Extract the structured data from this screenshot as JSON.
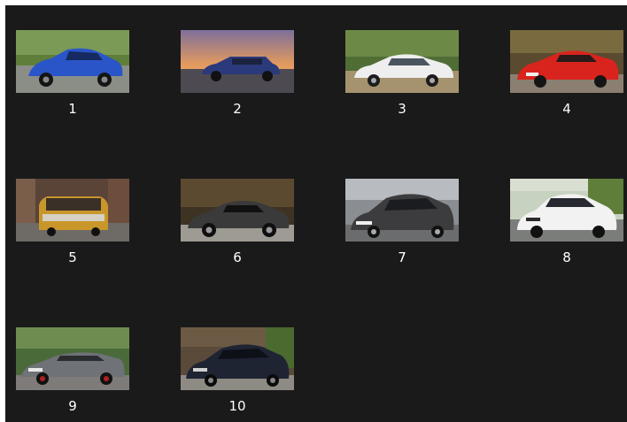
{
  "gallery": {
    "items": [
      {
        "label": "1",
        "car_color": "#2a55c8",
        "bg": "#6f8f4a"
      },
      {
        "label": "2",
        "car_color": "#2b3a7a",
        "bg": "#b97a5a"
      },
      {
        "label": "3",
        "car_color": "#eeeeee",
        "bg": "#5c7a3a"
      },
      {
        "label": "4",
        "car_color": "#d8241c",
        "bg": "#6a5a3a"
      },
      {
        "label": "5",
        "car_color": "#c9962a",
        "bg": "#6a5040"
      },
      {
        "label": "6",
        "car_color": "#3a3a3a",
        "bg": "#4a3a2a"
      },
      {
        "label": "7",
        "car_color": "#3c3c3e",
        "bg": "#8a8d91"
      },
      {
        "label": "8",
        "car_color": "#f2f2f2",
        "bg": "#7a8a6a"
      },
      {
        "label": "9",
        "car_color": "#6f7276",
        "bg": "#4a6a3a"
      },
      {
        "label": "10",
        "car_color": "#1f2433",
        "bg": "#5a4a3a"
      }
    ]
  }
}
